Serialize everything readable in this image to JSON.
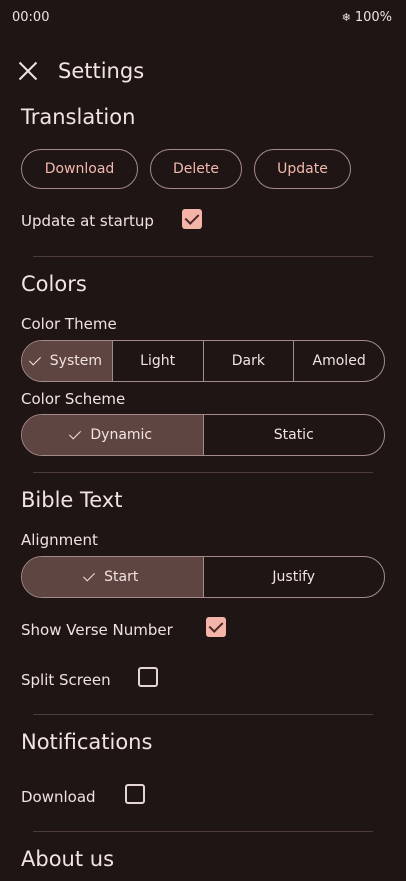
{
  "status_bar": {
    "time": "00:00",
    "battery": "100%"
  },
  "appbar": {
    "title": "Settings"
  },
  "translation": {
    "heading": "Translation",
    "download_label": "Download",
    "delete_label": "Delete",
    "update_label": "Update",
    "update_at_startup_label": "Update at startup",
    "update_at_startup_checked": true
  },
  "colors": {
    "heading": "Colors",
    "theme_label": "Color Theme",
    "theme_options": [
      "System",
      "Light",
      "Dark",
      "Amoled"
    ],
    "theme_selected": "System",
    "scheme_label": "Color Scheme",
    "scheme_options": [
      "Dynamic",
      "Static"
    ],
    "scheme_selected": "Dynamic"
  },
  "bible_text": {
    "heading": "Bible Text",
    "alignment_label": "Alignment",
    "alignment_options": [
      "Start",
      "Justify"
    ],
    "alignment_selected": "Start",
    "show_verse_number_label": "Show Verse Number",
    "show_verse_number_checked": true,
    "split_screen_label": "Split Screen",
    "split_screen_checked": false
  },
  "notifications": {
    "heading": "Notifications",
    "download_label": "Download",
    "download_checked": false
  },
  "about": {
    "heading": "About us"
  },
  "colors_palette": {
    "background": "#201515",
    "accent": "#f5b4aa",
    "selected_segment": "#5e4541",
    "outline": "#a28b88"
  }
}
